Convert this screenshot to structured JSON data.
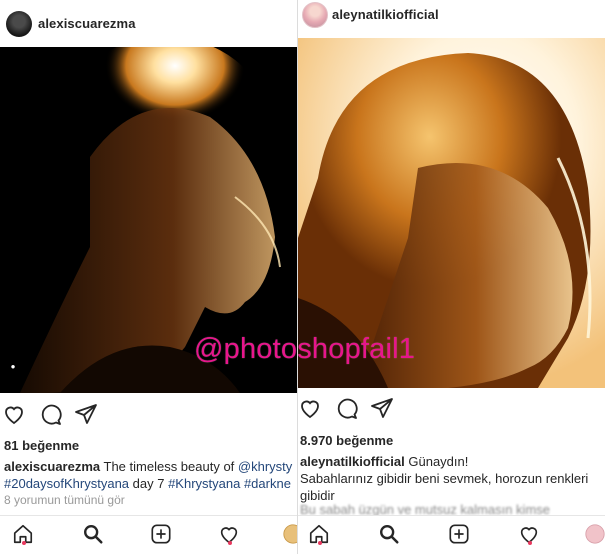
{
  "left_post": {
    "username": "alexiscuarezma",
    "likes": "81 beğenme",
    "caption_user": "alexiscuarezma",
    "caption_text": " The timeless beauty of ",
    "caption_mention": "@khrysty",
    "caption_hashtag1": "#20daysofKhrystyana",
    "caption_mid": " day 7 ",
    "caption_hashtag2": "#Khrystyana",
    "caption_hashtag3": "#darkne",
    "view_comments": "8 yorumun tümünü gör"
  },
  "right_post": {
    "username": "aleynatilkiofficial",
    "likes": "8.970 beğenme",
    "caption_user": "aleynatilkiofficial",
    "caption_text": " Günaydın!",
    "caption_line2": "Sabahlarınız gibidir beni sevmek, horozun renkleri gibidir",
    "caption_cutoff": "Bu sabah üzgün ve mutsuz kalmasın kimse"
  },
  "watermark": "@photoshopfail1",
  "colors": {
    "watermark": "#e8158c",
    "notification_dot": "#e8395f",
    "link": "#24477a"
  },
  "icons": {
    "actions": [
      "heart-icon",
      "comment-icon",
      "share-icon"
    ],
    "tabs": [
      "home-icon",
      "search-icon",
      "add-icon",
      "activity-icon",
      "profile-icon"
    ]
  }
}
